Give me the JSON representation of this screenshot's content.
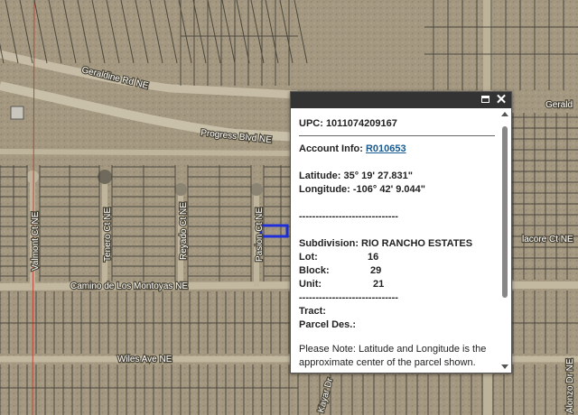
{
  "map": {
    "roads_horizontal": [
      "Geraldine Rd NE",
      "Progress Blvd NE",
      "Camino de Los Montoyas NE",
      "Wiles Ave NE",
      "Gerald",
      "lacore Ct NE"
    ],
    "roads_vertical": [
      "Valmont Ct NE",
      "Tenero Ct NE",
      "Reyado Ct NE",
      "Pasion Ct NE",
      "Alonzo Dr NE",
      "Kayar Dr"
    ],
    "selected_parcel_color": "#1f2fd8",
    "vacant_land_color": "#a59a82",
    "parcel_line_color": "#3f3b33"
  },
  "popup": {
    "upc": "UPC: 1011074209167",
    "account_label": "Account Info:",
    "account_link": "R010653",
    "latitude": "Latitude: 35° 19' 27.831\"",
    "longitude": "Longitude: -106° 42' 9.044\"",
    "separator": "------------------------------",
    "subdivision": "Subdivision: RIO RANCHO ESTATES",
    "lot_label": "Lot:",
    "lot_value": "16",
    "block_label": "Block:",
    "block_value": "29",
    "unit_label": "Unit:",
    "unit_value": "21",
    "separator2": "------------------------------",
    "tract_label": "Tract:",
    "parcel_des_label": "Parcel Des.:",
    "note": "Please Note: Latitude and Longitude is the approximate center of the parcel shown.",
    "maximize_icon": "maximize-icon",
    "close_icon": "close-icon",
    "close_glyph": "✕"
  }
}
